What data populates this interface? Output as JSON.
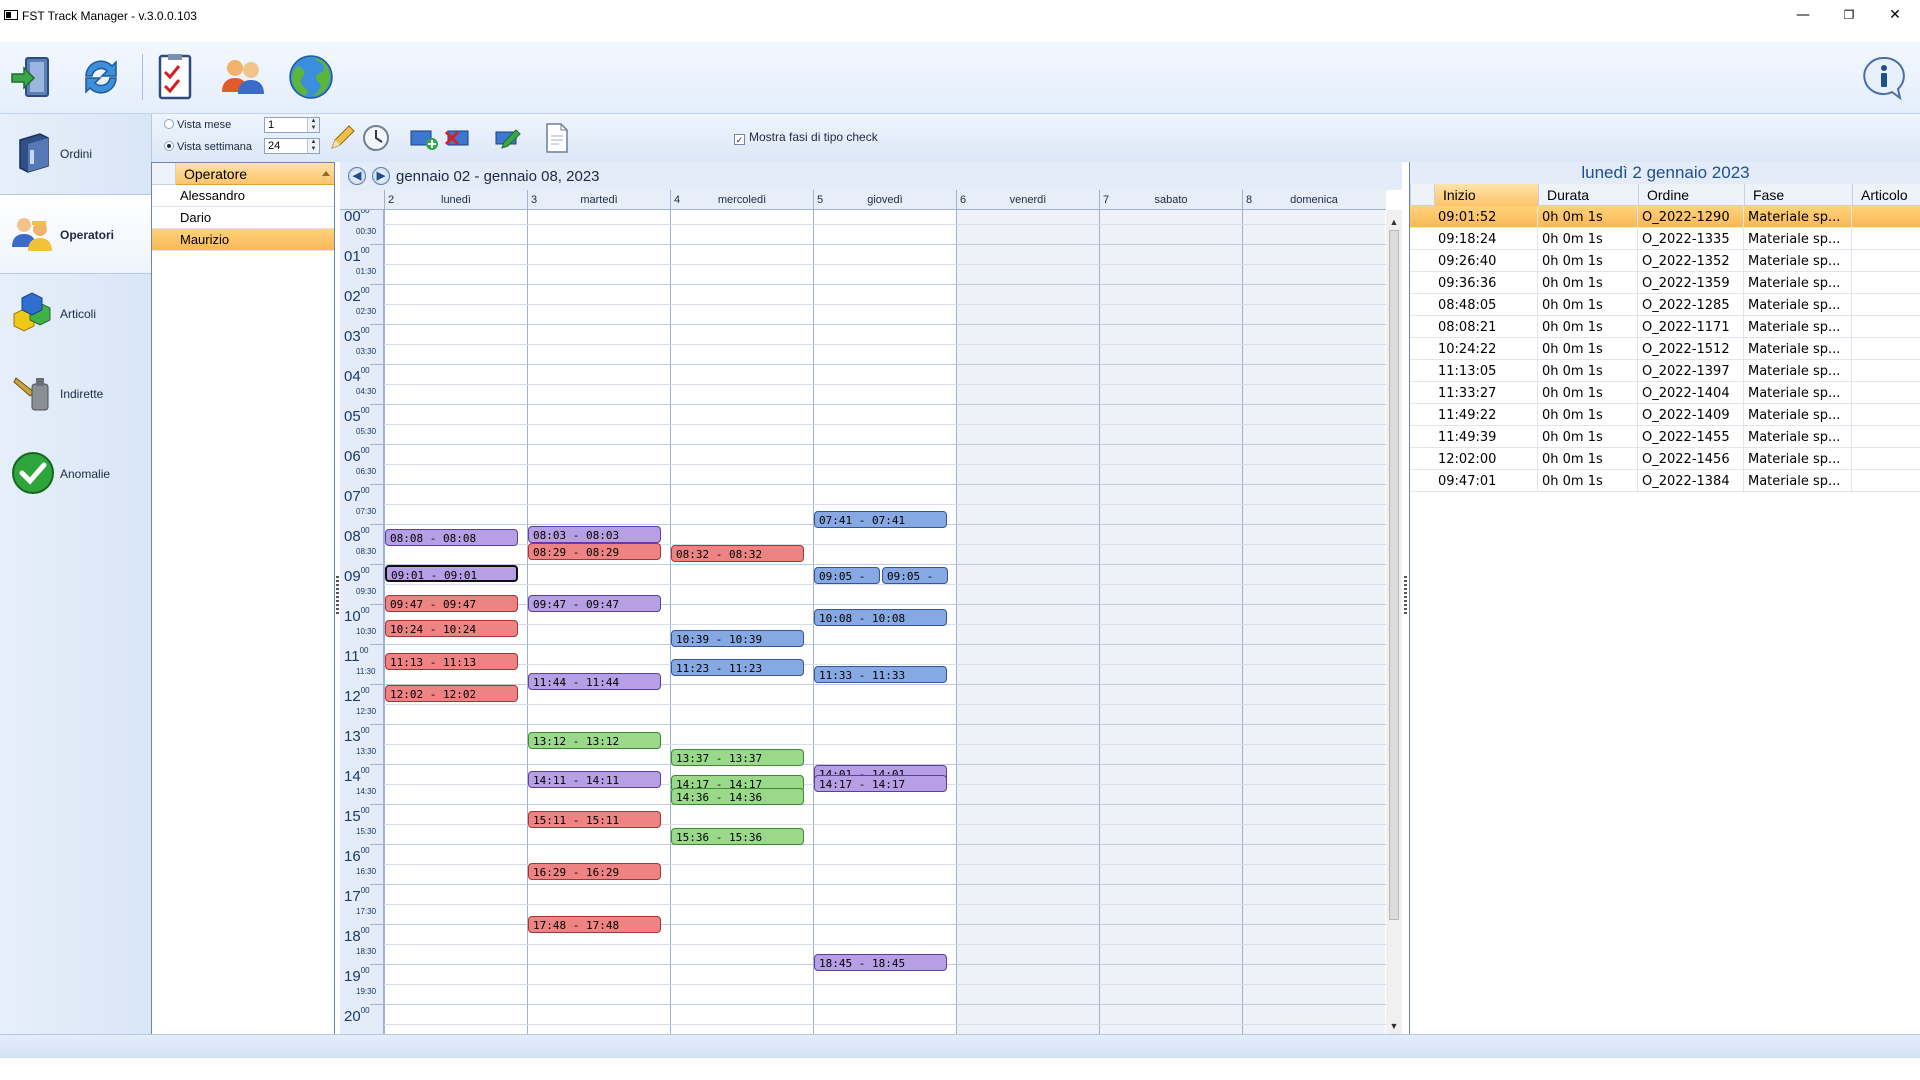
{
  "app": {
    "title": "FST Track Manager - v.3.0.0.103"
  },
  "window": {
    "minimize": "—",
    "restore": "❐",
    "close": "✕"
  },
  "ribbon": {
    "buttons": [
      {
        "name": "exit-door-icon"
      },
      {
        "name": "refresh-icon"
      },
      {
        "name": "checklist-icon"
      },
      {
        "name": "users-icon"
      },
      {
        "name": "globe-icon"
      }
    ],
    "info": "i"
  },
  "nav": {
    "items": [
      {
        "label": "Ordini",
        "icon": "database-icon"
      },
      {
        "label": "Operatori",
        "icon": "operators-icon",
        "active": true
      },
      {
        "label": "Articoli",
        "icon": "cubes-icon"
      },
      {
        "label": "Indirette",
        "icon": "tools-icon"
      },
      {
        "label": "Anomalie",
        "icon": "check-icon"
      }
    ]
  },
  "toolbar": {
    "vista_mese": "Vista mese",
    "vista_mese_value": "1",
    "vista_settimana": "Vista settimana",
    "vista_settimana_value": "24",
    "mostra_check": "Mostra fasi di tipo check"
  },
  "operators": {
    "header": "Operatore",
    "rows": [
      "Alessandro",
      "Dario",
      "Maurizio"
    ],
    "selected": "Maurizio"
  },
  "calendar": {
    "range": "gennaio 02 - gennaio 08, 2023",
    "days": [
      {
        "num": "2",
        "name": "lunedì"
      },
      {
        "num": "3",
        "name": "martedì"
      },
      {
        "num": "4",
        "name": "mercoledì"
      },
      {
        "num": "5",
        "name": "giovedì"
      },
      {
        "num": "6",
        "name": "venerdì"
      },
      {
        "num": "7",
        "name": "sabato"
      },
      {
        "num": "8",
        "name": "domenica"
      }
    ],
    "hours": [
      "00",
      "01",
      "02",
      "03",
      "04",
      "05",
      "06",
      "07",
      "08",
      "09",
      "10",
      "11",
      "12",
      "13",
      "14",
      "15",
      "16",
      "17",
      "18",
      "19",
      "20"
    ],
    "half_hours": [
      "00:30",
      "01:30",
      "02:30",
      "03:30",
      "04:30",
      "05:30",
      "06:30",
      "07:30",
      "08:30",
      "09:30",
      "10:30",
      "11:30",
      "12:30",
      "13:30",
      "14:30",
      "15:30",
      "16:30",
      "17:30",
      "18:30",
      "19:30"
    ],
    "minute_superscript": "00",
    "events": [
      {
        "day": 0,
        "start": "08:08",
        "label": "08:08 - 08:08",
        "color": "purple"
      },
      {
        "day": 0,
        "start": "09:01",
        "label": "09:01 - 09:01",
        "color": "purple",
        "selected": true
      },
      {
        "day": 0,
        "start": "09:47",
        "label": "09:47 - 09:47",
        "color": "red"
      },
      {
        "day": 0,
        "start": "10:24",
        "label": "10:24 - 10:24",
        "color": "red"
      },
      {
        "day": 0,
        "start": "11:13",
        "label": "11:13 - 11:13",
        "color": "red"
      },
      {
        "day": 0,
        "start": "12:02",
        "label": "12:02 - 12:02",
        "color": "red"
      },
      {
        "day": 1,
        "start": "08:03",
        "label": "08:03 - 08:03",
        "color": "purple"
      },
      {
        "day": 1,
        "start": "08:29",
        "label": "08:29 - 08:29",
        "color": "red"
      },
      {
        "day": 1,
        "start": "09:47",
        "label": "09:47 - 09:47",
        "color": "purple"
      },
      {
        "day": 1,
        "start": "11:44",
        "label": "11:44 - 11:44",
        "color": "purple"
      },
      {
        "day": 1,
        "start": "13:12",
        "label": "13:12 - 13:12",
        "color": "green"
      },
      {
        "day": 1,
        "start": "14:11",
        "label": "14:11 - 14:11",
        "color": "purple"
      },
      {
        "day": 1,
        "start": "15:11",
        "label": "15:11 - 15:11",
        "color": "red"
      },
      {
        "day": 1,
        "start": "16:29",
        "label": "16:29 - 16:29",
        "color": "red"
      },
      {
        "day": 1,
        "start": "17:48",
        "label": "17:48 - 17:48",
        "color": "red"
      },
      {
        "day": 2,
        "start": "08:32",
        "label": "08:32 - 08:32",
        "color": "red"
      },
      {
        "day": 2,
        "start": "10:39",
        "label": "10:39 - 10:39",
        "color": "blue"
      },
      {
        "day": 2,
        "start": "11:23",
        "label": "11:23 - 11:23",
        "color": "blue"
      },
      {
        "day": 2,
        "start": "13:37",
        "label": "13:37 - 13:37",
        "color": "green"
      },
      {
        "day": 2,
        "start": "14:17",
        "label": "14:17 - 14:17",
        "color": "green"
      },
      {
        "day": 2,
        "start": "14:36",
        "label": "14:36 - 14:36",
        "color": "green"
      },
      {
        "day": 2,
        "start": "15:36",
        "label": "15:36 - 15:36",
        "color": "green"
      },
      {
        "day": 3,
        "start": "07:41",
        "label": "07:41 - 07:41",
        "color": "blue"
      },
      {
        "day": 3,
        "start": "09:05",
        "label": "09:05 -",
        "color": "blue",
        "half": "left"
      },
      {
        "day": 3,
        "start": "09:05",
        "label": "09:05 -",
        "color": "blue",
        "half": "right"
      },
      {
        "day": 3,
        "start": "10:08",
        "label": "10:08 - 10:08",
        "color": "blue"
      },
      {
        "day": 3,
        "start": "11:33",
        "label": "11:33 - 11:33",
        "color": "blue"
      },
      {
        "day": 3,
        "start": "14:01",
        "label": "14:01 - 14:01",
        "color": "purple"
      },
      {
        "day": 3,
        "start": "14:17",
        "label": "14:17 - 14:17",
        "color": "purple"
      },
      {
        "day": 3,
        "start": "18:45",
        "label": "18:45 - 18:45",
        "color": "purple"
      }
    ]
  },
  "details": {
    "title": "lunedì 2 gennaio 2023",
    "columns": [
      "Inizio",
      "Durata",
      "Ordine",
      "Fase",
      "Articolo"
    ],
    "rows": [
      [
        "09:01:52",
        "0h 0m 1s",
        "O_2022-1290",
        "Materiale sp...",
        ""
      ],
      [
        "09:18:24",
        "0h 0m 1s",
        "O_2022-1335",
        "Materiale sp...",
        ""
      ],
      [
        "09:26:40",
        "0h 0m 1s",
        "O_2022-1352",
        "Materiale sp...",
        ""
      ],
      [
        "09:36:36",
        "0h 0m 1s",
        "O_2022-1359",
        "Materiale sp...",
        ""
      ],
      [
        "08:48:05",
        "0h 0m 1s",
        "O_2022-1285",
        "Materiale sp...",
        ""
      ],
      [
        "08:08:21",
        "0h 0m 1s",
        "O_2022-1171",
        "Materiale sp...",
        ""
      ],
      [
        "10:24:22",
        "0h 0m 1s",
        "O_2022-1512",
        "Materiale sp...",
        ""
      ],
      [
        "11:13:05",
        "0h 0m 1s",
        "O_2022-1397",
        "Materiale sp...",
        ""
      ],
      [
        "11:33:27",
        "0h 0m 1s",
        "O_2022-1404",
        "Materiale sp...",
        ""
      ],
      [
        "11:49:22",
        "0h 0m 1s",
        "O_2022-1409",
        "Materiale sp...",
        ""
      ],
      [
        "11:49:39",
        "0h 0m 1s",
        "O_2022-1455",
        "Materiale sp...",
        ""
      ],
      [
        "12:02:00",
        "0h 0m 1s",
        "O_2022-1456",
        "Materiale sp...",
        ""
      ],
      [
        "09:47:01",
        "0h 0m 1s",
        "O_2022-1384",
        "Materiale sp...",
        ""
      ]
    ]
  },
  "colors": {
    "purple": "#b79fe6",
    "red": "#ee8383",
    "green": "#9ad98a",
    "blue": "#86a8e3",
    "selection": "#f9b857",
    "accent": "#1f4f90"
  }
}
